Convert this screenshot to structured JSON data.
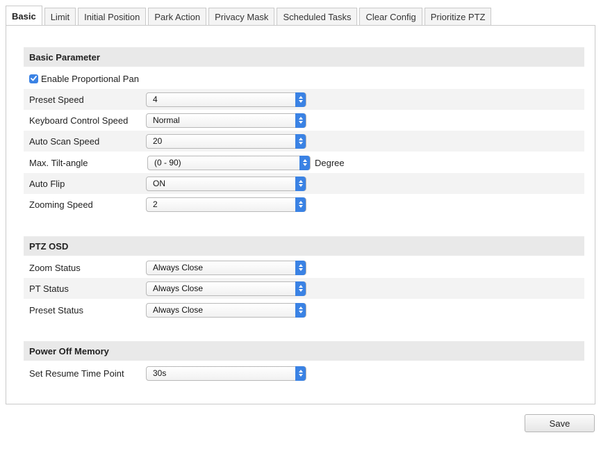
{
  "tabs": [
    "Basic",
    "Limit",
    "Initial Position",
    "Park Action",
    "Privacy Mask",
    "Scheduled Tasks",
    "Clear Config",
    "Prioritize PTZ"
  ],
  "active_tab": "Basic",
  "basic_parameter": {
    "title": "Basic Parameter",
    "enable_proportional_pan": {
      "label": "Enable Proportional Pan",
      "checked": true
    },
    "preset_speed": {
      "label": "Preset Speed",
      "value": "4"
    },
    "keyboard_control_speed": {
      "label": "Keyboard Control Speed",
      "value": "Normal"
    },
    "auto_scan_speed": {
      "label": "Auto Scan Speed",
      "value": "20"
    },
    "max_tilt_angle": {
      "label": "Max. Tilt-angle",
      "value": "(0 - 90)",
      "unit": "Degree"
    },
    "auto_flip": {
      "label": "Auto Flip",
      "value": "ON"
    },
    "zooming_speed": {
      "label": "Zooming Speed",
      "value": "2"
    }
  },
  "ptz_osd": {
    "title": "PTZ OSD",
    "zoom_status": {
      "label": "Zoom Status",
      "value": "Always Close"
    },
    "pt_status": {
      "label": "PT Status",
      "value": "Always Close"
    },
    "preset_status": {
      "label": "Preset Status",
      "value": "Always Close"
    }
  },
  "power_off_memory": {
    "title": "Power Off Memory",
    "set_resume_time_point": {
      "label": "Set Resume Time Point",
      "value": "30s"
    }
  },
  "save_label": "Save",
  "colors": {
    "accent": "#3a82e4",
    "header_bg": "#e9e9e9",
    "row_shade": "#f3f3f3"
  }
}
